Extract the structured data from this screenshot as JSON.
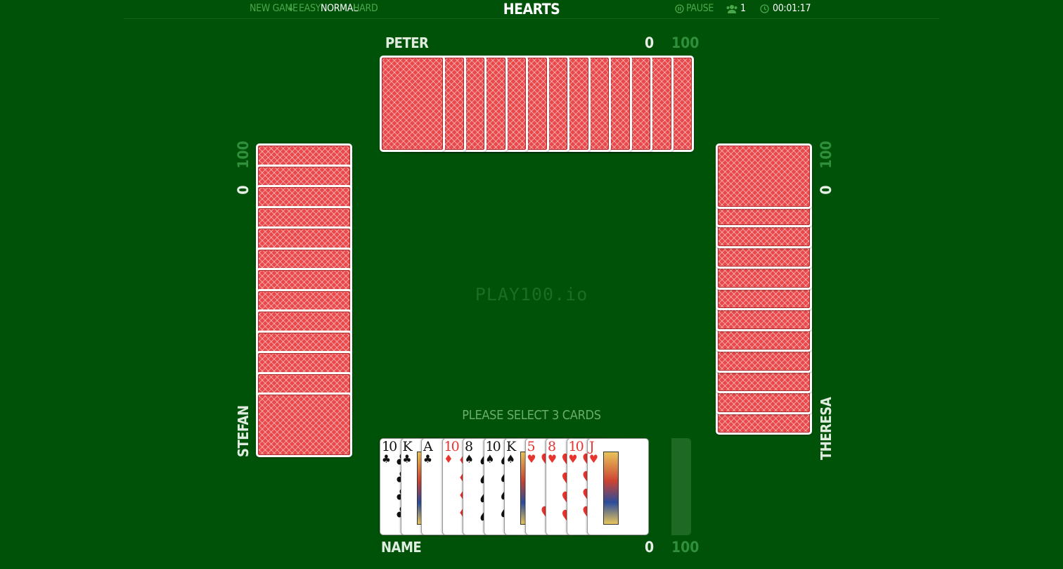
{
  "toolbar": {
    "new_game": "NEW GAME",
    "arrow": "▸",
    "easy": "EASY",
    "normal": "NORMAL",
    "hard": "HARD",
    "title": "HEARTS",
    "pause_icon": "pause-icon",
    "pause": "PAUSE",
    "players_icon": "users-icon",
    "players": "1",
    "clock_icon": "clock-icon",
    "time": "00:01:17"
  },
  "players": {
    "north": {
      "name": "PETER",
      "score": "0",
      "limit": "100"
    },
    "west": {
      "name": "STEFAN",
      "score": "0",
      "limit": "100"
    },
    "east": {
      "name": "THERESA",
      "score": "0",
      "limit": "100"
    },
    "south": {
      "name": "NAME",
      "score": "0",
      "limit": "100"
    }
  },
  "center": {
    "logo": "PLAY100.io",
    "hint": "PLEASE SELECT 3 CARDS"
  },
  "hand": [
    {
      "rank": "10",
      "suit": "♣",
      "color": "black"
    },
    {
      "rank": "K",
      "suit": "♣",
      "color": "black"
    },
    {
      "rank": "A",
      "suit": "♣",
      "color": "black"
    },
    {
      "rank": "10",
      "suit": "♦",
      "color": "red"
    },
    {
      "rank": "8",
      "suit": "♠",
      "color": "black"
    },
    {
      "rank": "10",
      "suit": "♠",
      "color": "black"
    },
    {
      "rank": "K",
      "suit": "♠",
      "color": "black"
    },
    {
      "rank": "5",
      "suit": "♥",
      "color": "red"
    },
    {
      "rank": "8",
      "suit": "♥",
      "color": "red"
    },
    {
      "rank": "10",
      "suit": "♥",
      "color": "red"
    },
    {
      "rank": "J",
      "suit": "♥",
      "color": "red"
    }
  ],
  "colors": {
    "felt": "#005209",
    "card_back": "#e9494a",
    "red_suit": "#e8342f"
  }
}
